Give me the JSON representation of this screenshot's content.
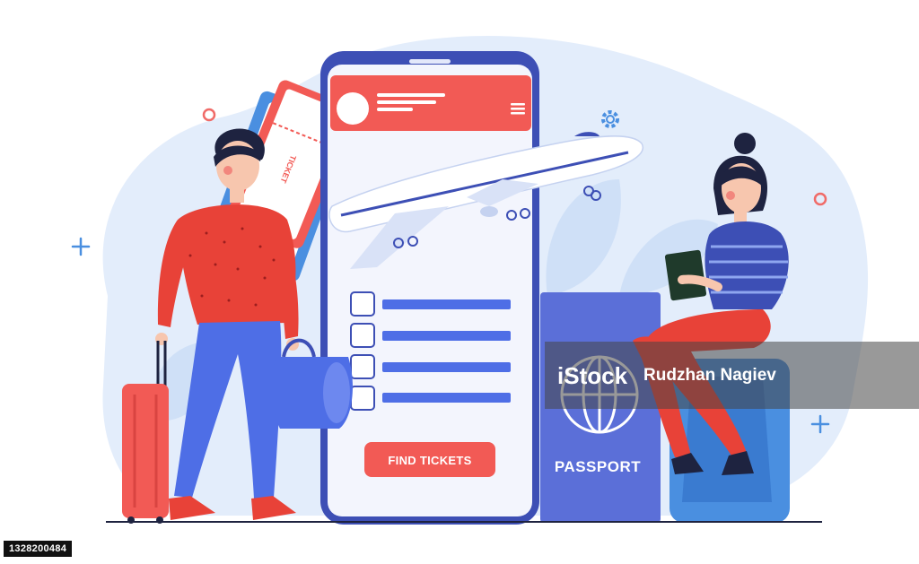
{
  "app": {
    "find_button_label": "FIND TICKETS",
    "passport_label": "PASSPORT",
    "ticket_label": "TICKET",
    "checklist_count": 4
  },
  "watermark": {
    "logo": "iStock",
    "credit": "Rudzhan Nagiev"
  },
  "stock_id": "1328200484",
  "colors": {
    "accent_red": "#f25a55",
    "phone_frame": "#3d4fb5",
    "background_blob": "#e4eefb",
    "passport_blue": "#5b6fd8",
    "checklist_blue": "#4e6ee6"
  }
}
